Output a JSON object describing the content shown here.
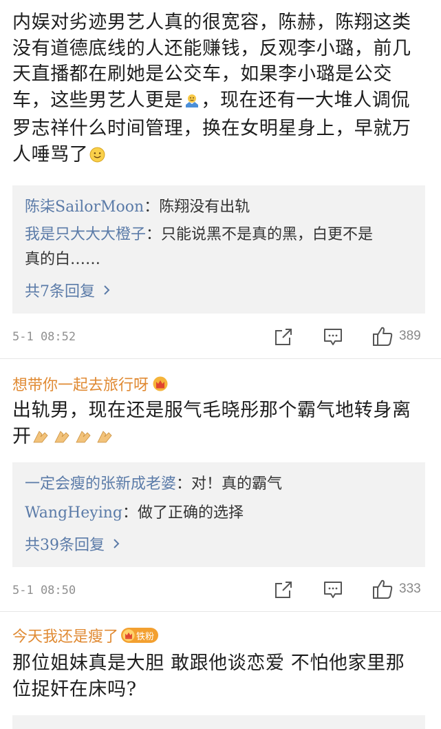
{
  "comments": [
    {
      "text_lines": [
        "内娱对劣迹男艺人真的很宽容，陈赫，陈翔这类",
        "没有道德底线的人还能赚钱，反观李小璐，前几",
        "天直播都在刷她是公交车，如果李小璐是公交",
        "车，这些男艺人更是",
        "，现在还有一大堆人调侃",
        "罗志祥什么时间管理，换在女明星身上，早就万",
        "人唾骂了"
      ],
      "replies": [
        {
          "user": "陈柒SailorMoon",
          "sep": "：",
          "text": "陈翔没有出轨",
          "text2": ""
        },
        {
          "user": "我是只大大大橙子",
          "sep": "：",
          "text": "只能说黑不是真的黑，白更不是",
          "text2": "真的白……"
        }
      ],
      "more_label": "共7条回复",
      "time": "5-1 08:52",
      "likes": "389"
    },
    {
      "author": "想带你一起去旅行呀",
      "text_lines": [
        "出轨男，现在还是服气毛晓彤那个霸气地转身离",
        "开"
      ],
      "replies": [
        {
          "user": "一定会瘦的张新成老婆",
          "sep": "：",
          "text": "对！真的霸气"
        },
        {
          "user": "WangHeying",
          "sep": "：",
          "text": "做了正确的选择"
        }
      ],
      "more_label": "共39条回复",
      "time": "5-1 08:50",
      "likes": "333"
    },
    {
      "author": "今天我还是瘦了",
      "badge": "铁粉",
      "text_lines": [
        "那位姐妹真是大胆 敢跟他谈恋爱 不怕他家里那",
        "位捉奸在床吗?"
      ]
    }
  ],
  "colors": {
    "author": "#e08a33",
    "link": "#5b7ba8",
    "reply_bg": "#f2f2f2",
    "meta": "#909090"
  },
  "icons": {
    "share": "share-icon",
    "comment": "comment-icon",
    "like": "thumbs-up-icon",
    "crown": "crown-badge-icon",
    "chevron": "chevron-right-icon"
  }
}
